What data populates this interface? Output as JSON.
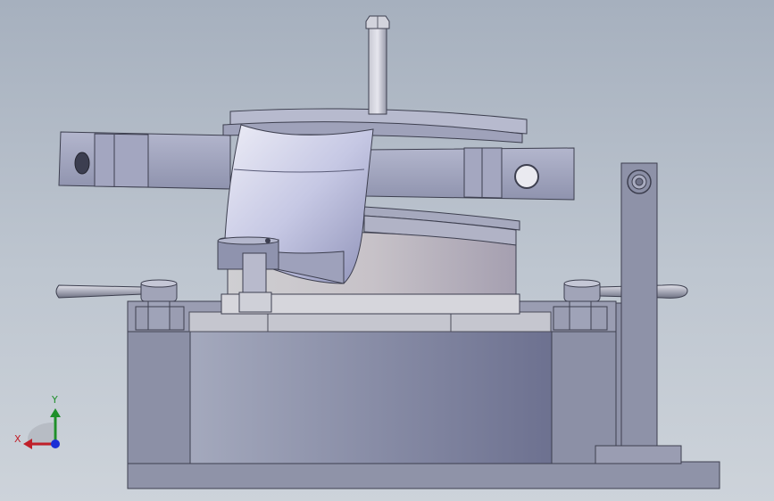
{
  "viewport": {
    "view_name": "",
    "background_top": "#a6b0be",
    "background_bottom": "#cdd3da"
  },
  "triad": {
    "x_label": "X",
    "y_label": "Y",
    "x_color": "#c0202a",
    "y_color": "#1f8f2a",
    "z_color": "#1b2fd6"
  },
  "model": {
    "parts": [
      "base-plate",
      "base-housing",
      "rotary-drum",
      "clamp-arm",
      "curved-clamp-jaw",
      "top-rod",
      "left-handle",
      "right-handle",
      "vertical-support-post",
      "locating-pin"
    ],
    "body_color": "#8d94ab",
    "highlight_color": "#c8cbe0"
  }
}
